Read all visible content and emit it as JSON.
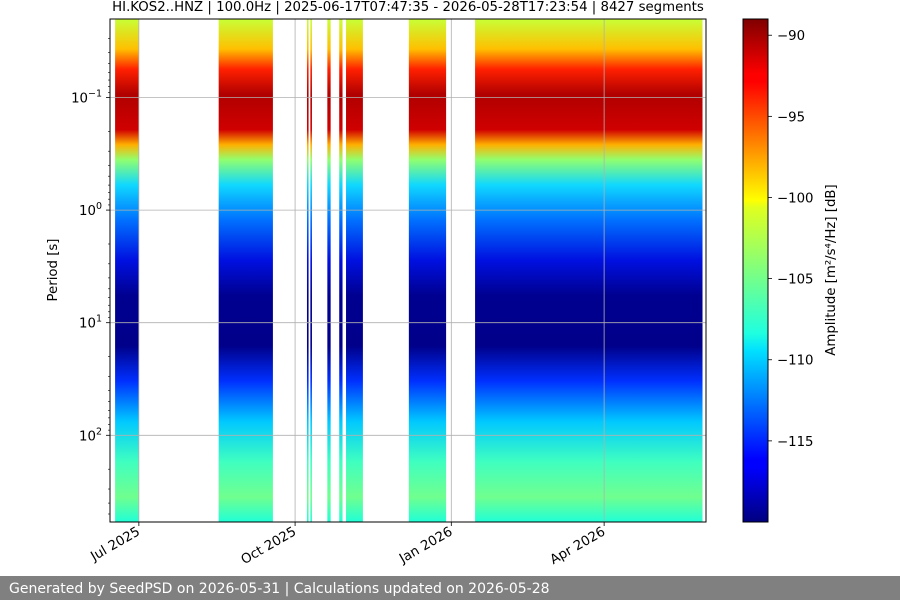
{
  "chart_data": {
    "type": "heatmap",
    "title": "HI.KOS2..HNZ | 100.0Hz | 2025-06-17T07:47:35 - 2026-05-28T17:23:54 | 8427 segments",
    "ylabel": "Period [s]",
    "xlabel": "",
    "y_scale": "log",
    "y_inverted": true,
    "x_tick_labels": [
      "Jul 2025",
      "Oct 2025",
      "Jan 2026",
      "Apr 2026"
    ],
    "x_ticks": [
      "2025-07-01",
      "2025-10-01",
      "2026-01-01",
      "2026-04-01"
    ],
    "y_ticks": [
      0.1,
      1,
      10,
      100
    ],
    "y_tick_labels": [
      {
        "base": "10",
        "exp": "−1"
      },
      {
        "base": "10",
        "exp": "0"
      },
      {
        "base": "10",
        "exp": "1"
      },
      {
        "base": "10",
        "exp": "2"
      }
    ],
    "grid": true,
    "colorbar": {
      "label": "Amplitude [m²/s⁴/Hz] [dB]",
      "colormap": "jet",
      "range": [
        -120,
        -89
      ],
      "ticks": [
        -90,
        -95,
        -100,
        -105,
        -110,
        -115
      ],
      "tick_labels": [
        "−90",
        "−95",
        "−100",
        "−105",
        "−110",
        "−115"
      ]
    },
    "data_periods": [
      {
        "start": "2025-06-17",
        "end": "2025-06-30"
      },
      {
        "start": "2025-08-17",
        "end": "2025-09-17"
      },
      {
        "start": "2025-10-08",
        "end": "2025-10-08"
      },
      {
        "start": "2025-10-10",
        "end": "2025-10-10"
      },
      {
        "start": "2025-10-20",
        "end": "2025-10-21"
      },
      {
        "start": "2025-10-27",
        "end": "2025-10-28"
      },
      {
        "start": "2025-10-31",
        "end": "2025-11-09"
      },
      {
        "start": "2025-12-07",
        "end": "2025-12-28"
      },
      {
        "start": "2026-01-15",
        "end": "2026-05-28"
      }
    ]
  },
  "footer": {
    "text": "Generated by SeedPSD on 2026-05-31 | Calculations updated on 2026-05-28"
  }
}
